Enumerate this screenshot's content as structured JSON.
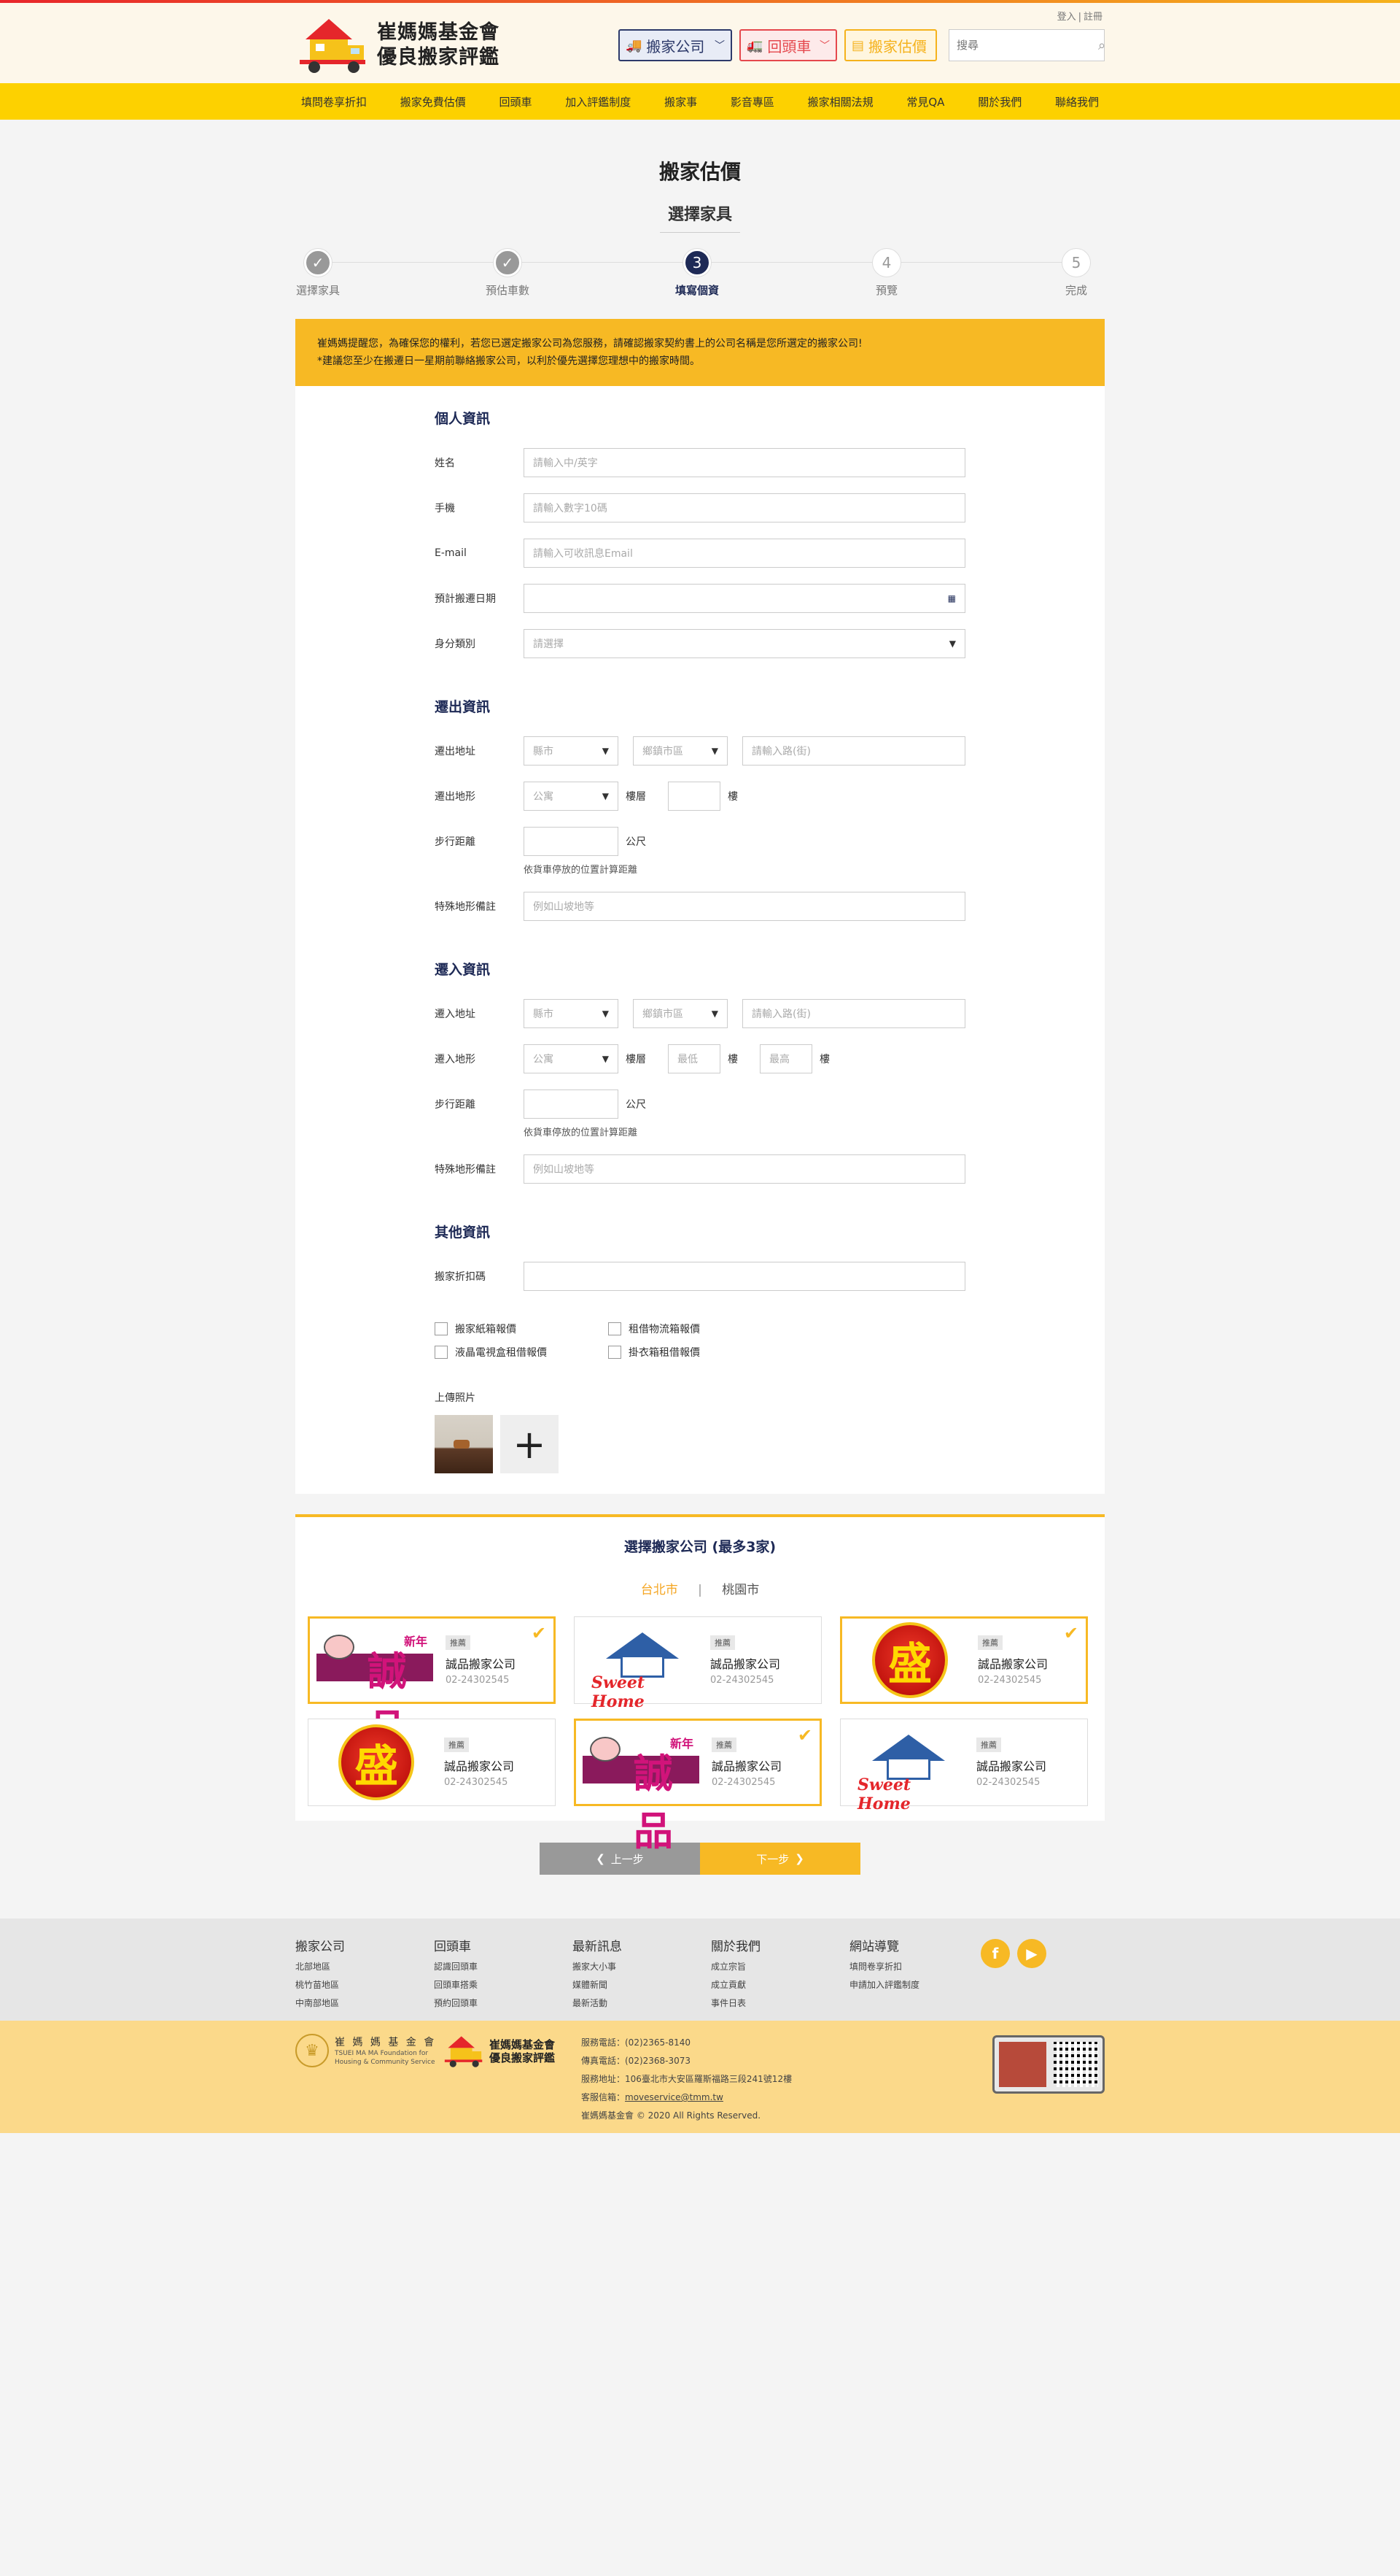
{
  "header": {
    "logo_line1": "崔媽媽基金會",
    "logo_line2": "優良搬家評鑑",
    "login": "登入",
    "register": "註冊",
    "btn_movers": "搬家公司",
    "btn_return": "回頭車",
    "btn_estimate": "搬家估價",
    "search_placeholder": "搜尋"
  },
  "nav": [
    "填問卷享折扣",
    "搬家免費估價",
    "回頭車",
    "加入評鑑制度",
    "搬家事",
    "影音專區",
    "搬家相關法規",
    "常見QA",
    "關於我們",
    "聯絡我們"
  ],
  "page": {
    "title": "搬家估價",
    "subtitle": "選擇家具"
  },
  "steps": [
    {
      "num": "✓",
      "label": "選擇家具",
      "state": "done"
    },
    {
      "num": "✓",
      "label": "預估車數",
      "state": "done"
    },
    {
      "num": "3",
      "label": "填寫個資",
      "state": "cur"
    },
    {
      "num": "4",
      "label": "預覽",
      "state": "todo"
    },
    {
      "num": "5",
      "label": "完成",
      "state": "todo"
    }
  ],
  "notice": {
    "line1": "崔媽媽提醒您，為確保您的權利，若您已選定搬家公司為您服務，請確認搬家契約書上的公司名稱是您所選定的搬家公司!",
    "line2": "*建議您至少在搬遷日一星期前聯絡搬家公司，以利於優先選擇您理想中的搬家時間。"
  },
  "personal": {
    "title": "個人資訊",
    "name_label": "姓名",
    "name_ph": "請輸入中/英字",
    "phone_label": "手機",
    "phone_ph": "請輸入數字10碼",
    "email_label": "E-mail",
    "email_ph": "請輸入可收訊息Email",
    "date_label": "預計搬遷日期",
    "identity_label": "身分類別",
    "identity_value": "請選擇"
  },
  "moveout": {
    "title": "遷出資訊",
    "addr_label": "遷出地址",
    "city": "縣市",
    "district": "鄉鎮市區",
    "road_ph": "請輸入路(街)",
    "terrain_label": "遷出地形",
    "terrain_value": "公寓",
    "floor_label": "樓層",
    "floor_unit": "樓",
    "walk_label": "步行距離",
    "walk_unit": "公尺",
    "walk_hint": "依貨車停放的位置計算距離",
    "special_label": "特殊地形備註",
    "special_ph": "例如山坡地等"
  },
  "movein": {
    "title": "遷入資訊",
    "addr_label": "遷入地址",
    "city": "縣市",
    "district": "鄉鎮市區",
    "road_ph": "請輸入路(街)",
    "terrain_label": "遷入地形",
    "terrain_value": "公寓",
    "floor_label": "樓層",
    "floor_min_ph": "最低",
    "floor_max_ph": "最高",
    "floor_unit": "樓",
    "walk_label": "步行距離",
    "walk_unit": "公尺",
    "walk_hint": "依貨車停放的位置計算距離",
    "special_label": "特殊地形備註",
    "special_ph": "例如山坡地等"
  },
  "other": {
    "title": "其他資訊",
    "discount_label": "搬家折扣碼",
    "checks": [
      "搬家紙箱報價",
      "租借物流箱報價",
      "液晶電視盒租借報價",
      "掛衣箱租借報價"
    ],
    "upload_label": "上傳照片"
  },
  "companies": {
    "title": "選擇搬家公司 (最多3家)",
    "tabs": [
      "台北市",
      "桃園市"
    ],
    "active_tab": "台北市",
    "list": [
      {
        "logo": "chengpin",
        "tag": "推薦",
        "name": "誠品搬家公司",
        "phone": "02-24302545",
        "selected": true
      },
      {
        "logo": "sweethome",
        "tag": "推薦",
        "name": "誠品搬家公司",
        "phone": "02-24302545",
        "selected": false
      },
      {
        "logo": "sheng",
        "tag": "推薦",
        "name": "誠品搬家公司",
        "phone": "02-24302545",
        "selected": true
      },
      {
        "logo": "sheng",
        "tag": "推薦",
        "name": "誠品搬家公司",
        "phone": "02-24302545",
        "selected": false
      },
      {
        "logo": "chengpin",
        "tag": "推薦",
        "name": "誠品搬家公司",
        "phone": "02-24302545",
        "selected": true
      },
      {
        "logo": "sweethome",
        "tag": "推薦",
        "name": "誠品搬家公司",
        "phone": "02-24302545",
        "selected": false
      }
    ],
    "logo_texts": {
      "sheng": "盛",
      "chengpin": "誠品",
      "newyear": "新年",
      "sweethome": "Sweet Home"
    }
  },
  "buttons": {
    "prev": "上一步",
    "next": "下一步"
  },
  "footer": {
    "cols": [
      {
        "title": "搬家公司",
        "items": [
          "北部地區",
          "桃竹苗地區",
          "中南部地區"
        ]
      },
      {
        "title": "回頭車",
        "items": [
          "認識回頭車",
          "回頭車搭乘",
          "預約回頭車"
        ]
      },
      {
        "title": "最新訊息",
        "items": [
          "搬家大小事",
          "媒體新聞",
          "最新活動"
        ]
      },
      {
        "title": "關於我們",
        "items": [
          "成立宗旨",
          "成立貢獻",
          "事件日表"
        ]
      },
      {
        "title": "網站導覽",
        "items": [
          "填問卷享折扣",
          "申請加入評鑑制度"
        ]
      }
    ],
    "org_name": "崔 媽 媽 基 金 會",
    "org_en1": "TSUEI MA MA Foundation for",
    "org_en2": "Housing & Community Service",
    "logo_line1": "崔媽媽基金會",
    "logo_line2": "優良搬家評鑑",
    "service_phone": "服務電話：(02)2365-8140",
    "fax": "傳真電話：(02)2368-3073",
    "address": "服務地址：106臺北市大安區羅斯福路三段241號12樓",
    "email_label": "客服信箱：",
    "email": "moveservice@tmm.tw",
    "copyright": "崔媽媽基金會 © 2020 All Rights Reserved."
  }
}
